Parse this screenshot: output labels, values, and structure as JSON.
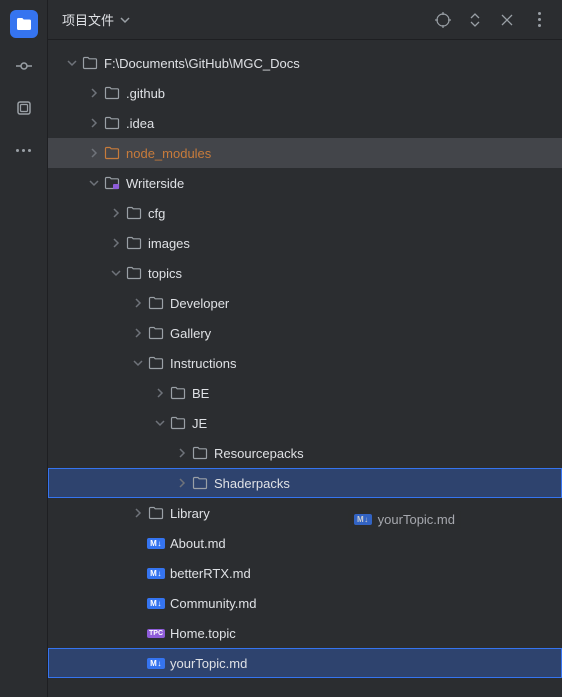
{
  "panel": {
    "title": "项目文件"
  },
  "tree": {
    "root": {
      "label": "F:\\Documents\\GitHub\\MGC_Docs"
    },
    "github": {
      "label": ".github"
    },
    "idea": {
      "label": ".idea"
    },
    "node_modules": {
      "label": "node_modules"
    },
    "writerside": {
      "label": "Writerside"
    },
    "cfg": {
      "label": "cfg"
    },
    "images": {
      "label": "images"
    },
    "topics": {
      "label": "topics"
    },
    "developer": {
      "label": "Developer"
    },
    "gallery": {
      "label": "Gallery"
    },
    "instructions": {
      "label": "Instructions"
    },
    "be": {
      "label": "BE"
    },
    "je": {
      "label": "JE"
    },
    "resourcepacks": {
      "label": "Resourcepacks"
    },
    "shaderpacks": {
      "label": "Shaderpacks"
    },
    "library": {
      "label": "Library"
    },
    "about": {
      "label": "About.md"
    },
    "betterrtx": {
      "label": "betterRTX.md"
    },
    "community": {
      "label": "Community.md"
    },
    "home": {
      "label": "Home.topic"
    },
    "yourtopic": {
      "label": "yourTopic.md"
    }
  },
  "drag": {
    "label": "yourTopic.md",
    "badge": "M↓"
  },
  "badges": {
    "md": "M↓",
    "topic": "TPC"
  }
}
